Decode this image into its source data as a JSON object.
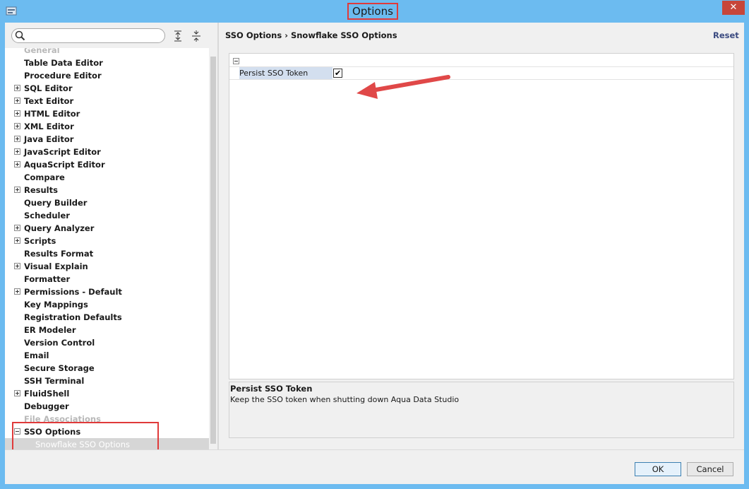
{
  "window": {
    "title": "Options",
    "close_label": "✕"
  },
  "search": {
    "value": "",
    "placeholder": ""
  },
  "tree": {
    "partial_top": "General",
    "items": [
      {
        "label": "Table Data Editor",
        "expandable": false
      },
      {
        "label": "Procedure Editor",
        "expandable": false
      },
      {
        "label": "SQL Editor",
        "expandable": true
      },
      {
        "label": "Text Editor",
        "expandable": true
      },
      {
        "label": "HTML Editor",
        "expandable": true
      },
      {
        "label": "XML Editor",
        "expandable": true
      },
      {
        "label": "Java Editor",
        "expandable": true
      },
      {
        "label": "JavaScript Editor",
        "expandable": true
      },
      {
        "label": "AquaScript Editor",
        "expandable": true
      },
      {
        "label": "Compare",
        "expandable": false
      },
      {
        "label": "Results",
        "expandable": true
      },
      {
        "label": "Query Builder",
        "expandable": false
      },
      {
        "label": "Scheduler",
        "expandable": false
      },
      {
        "label": "Query Analyzer",
        "expandable": true
      },
      {
        "label": "Scripts",
        "expandable": true
      },
      {
        "label": "Results Format",
        "expandable": false
      },
      {
        "label": "Visual Explain",
        "expandable": true
      },
      {
        "label": "Formatter",
        "expandable": false
      },
      {
        "label": "Permissions - Default",
        "expandable": true
      },
      {
        "label": "Key Mappings",
        "expandable": false
      },
      {
        "label": "Registration Defaults",
        "expandable": false
      },
      {
        "label": "ER Modeler",
        "expandable": false
      },
      {
        "label": "Version Control",
        "expandable": false
      },
      {
        "label": "Email",
        "expandable": false
      },
      {
        "label": "Secure Storage",
        "expandable": false
      },
      {
        "label": "SSH Terminal",
        "expandable": false
      },
      {
        "label": "FluidShell",
        "expandable": true
      },
      {
        "label": "Debugger",
        "expandable": false
      },
      {
        "label": "File Associations",
        "expandable": false,
        "disabled": true
      },
      {
        "label": "SSO Options",
        "expandable": true,
        "expanded": true
      },
      {
        "label": "Snowflake SSO Options",
        "child": true,
        "selected": true
      }
    ]
  },
  "right": {
    "breadcrumb": "SSO Options › Snowflake SSO Options",
    "reset_label": "Reset",
    "property": {
      "label": "Persist SSO Token",
      "checked": true
    },
    "description": {
      "title": "Persist SSO Token",
      "text": "Keep the SSO token when shutting down Aqua Data Studio"
    }
  },
  "buttons": {
    "ok": "OK",
    "cancel": "Cancel"
  },
  "colors": {
    "titlebar": "#6cbbf0",
    "highlight_box": "#e03a3a",
    "arrow": "#e04848",
    "selection": "#d6d6d6"
  },
  "icons": [
    "app-icon",
    "search-icon",
    "expand-all-icon",
    "collapse-all-icon",
    "close-icon",
    "checkmark-icon",
    "arrow-annotation"
  ]
}
